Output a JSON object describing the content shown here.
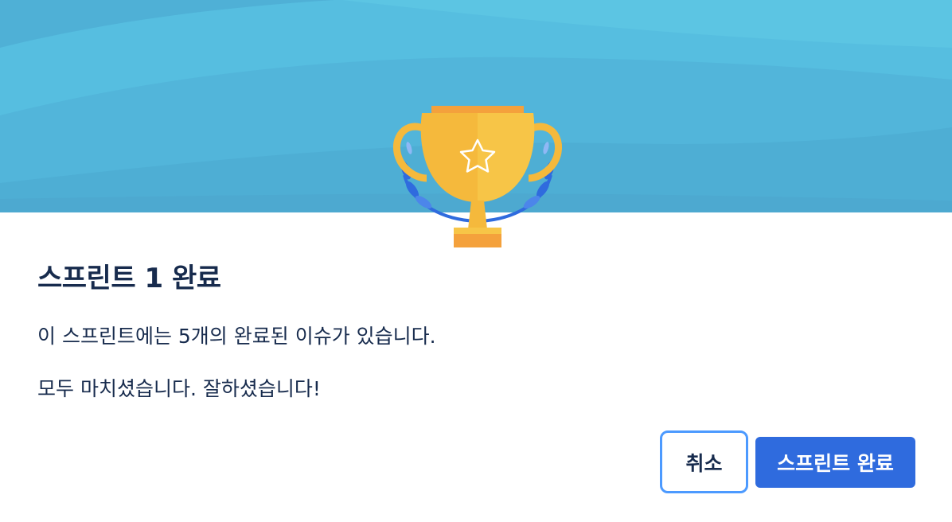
{
  "dialog": {
    "title": "스프린트 1 완료",
    "message_line1": "이 스프린트에는 5개의 완료된 이슈가 있습니다.",
    "message_line2": "모두 마치셨습니다. 잘하셨습니다!"
  },
  "buttons": {
    "cancel_label": "취소",
    "complete_label": "스프린트 완료"
  },
  "illustration": {
    "icon": "trophy-icon",
    "star_icon": "star-icon",
    "laurel_icon": "laurel-icon"
  },
  "colors": {
    "banner_light": "#5BC4E2",
    "banner_dark": "#4EAFD4",
    "trophy_gold": "#F5B93C",
    "trophy_base": "#F4A13C",
    "laurel_blue": "#2F6BDE",
    "primary_button": "#2F6BDE",
    "focus_ring": "#4C9AFF",
    "text": "#172B4D"
  }
}
